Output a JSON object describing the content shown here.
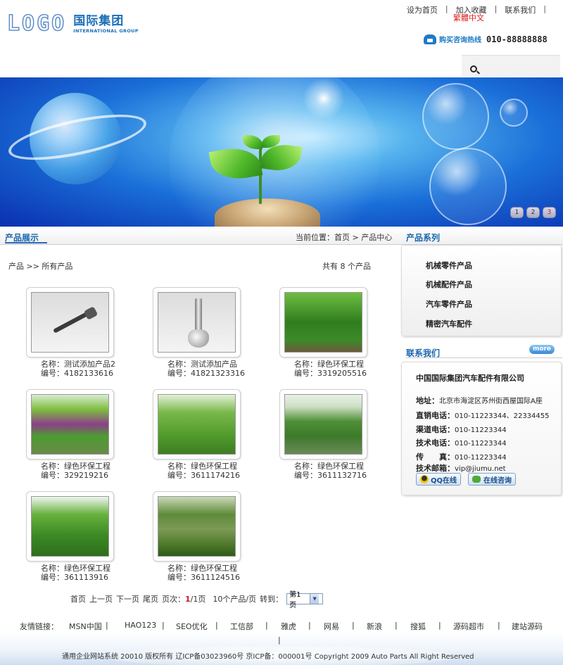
{
  "header": {
    "logo_mark": "LOGO",
    "logo_cn": "国际集团",
    "logo_en": "INTERNATIONAL GROUP",
    "top_links": [
      "设为首页",
      "加入收藏",
      "联系我们"
    ],
    "trad_link": "繁體中文",
    "hotline_label": "购买咨询热线",
    "hotline_number": "010-88888888"
  },
  "banner": {
    "dots": [
      "1",
      "2",
      "3"
    ]
  },
  "bar": {
    "title": "产品展示",
    "breadcrumb": "当前位置：首页 > 产品中心",
    "side_title": "产品系列"
  },
  "main": {
    "crumbs": "产品 >> 所有产品",
    "total": "共有 8 个产品",
    "products": [
      {
        "name": "名称：测试添加产品2",
        "code": "编号：4182133616"
      },
      {
        "name": "名称：测试添加产品",
        "code": "编号：41821323316"
      },
      {
        "name": "名称：绿色环保工程",
        "code": "编号：3319205516"
      },
      {
        "name": "名称：绿色环保工程",
        "code": "编号：329219216"
      },
      {
        "name": "名称：绿色环保工程",
        "code": "编号：3611174216"
      },
      {
        "name": "名称：绿色环保工程",
        "code": "编号：3611132716"
      },
      {
        "name": "名称：绿色环保工程",
        "code": "编号：361113916"
      },
      {
        "name": "名称：绿色环保工程",
        "code": "编号：3611124516"
      }
    ],
    "pager": {
      "first": "首页",
      "prev": "上一页",
      "next": "下一页",
      "last": "尾页",
      "page_label": "页次：",
      "page_current": "1",
      "page_total": "/1页",
      "per_page": "10个产品/页",
      "goto": "转到：",
      "select_value": "第1页"
    }
  },
  "sidebar": {
    "categories": [
      "机械零件产品",
      "机械配件产品",
      "汽车零件产品",
      "精密汽车配件"
    ],
    "contact_title": "联系我们",
    "more": "more",
    "company": "中国国际集团汽车配件有限公司",
    "address_label": "地址：",
    "address": "北京市海淀区苏州街西屋国际A座",
    "direct_label": "直销电话：",
    "direct": "010-11223344、22334455",
    "channel_label": "渠道电话：",
    "channel": "010-11223344",
    "tech_label": "技术电话：",
    "tech": "010-11223344",
    "fax_label": "传　　真：",
    "fax": "010-11223344",
    "email_label": "技术邮箱：",
    "email": "vip@jiumu.net",
    "qq_button": "QQ在线",
    "chat_button": "在线咨询"
  },
  "footer": {
    "links_label": "友情链接：",
    "links": [
      "MSN中国",
      "HAO123",
      "SEO优化",
      "工信部",
      "雅虎",
      "网易",
      "新浪",
      "搜狐",
      "源码超市",
      "建站源码"
    ],
    "copyright": "通用企业网站系统 20010 版权所有 辽ICP备03023960号 京ICP备：000001号 Copyright 2009 Auto Parts All Right Reserved"
  }
}
